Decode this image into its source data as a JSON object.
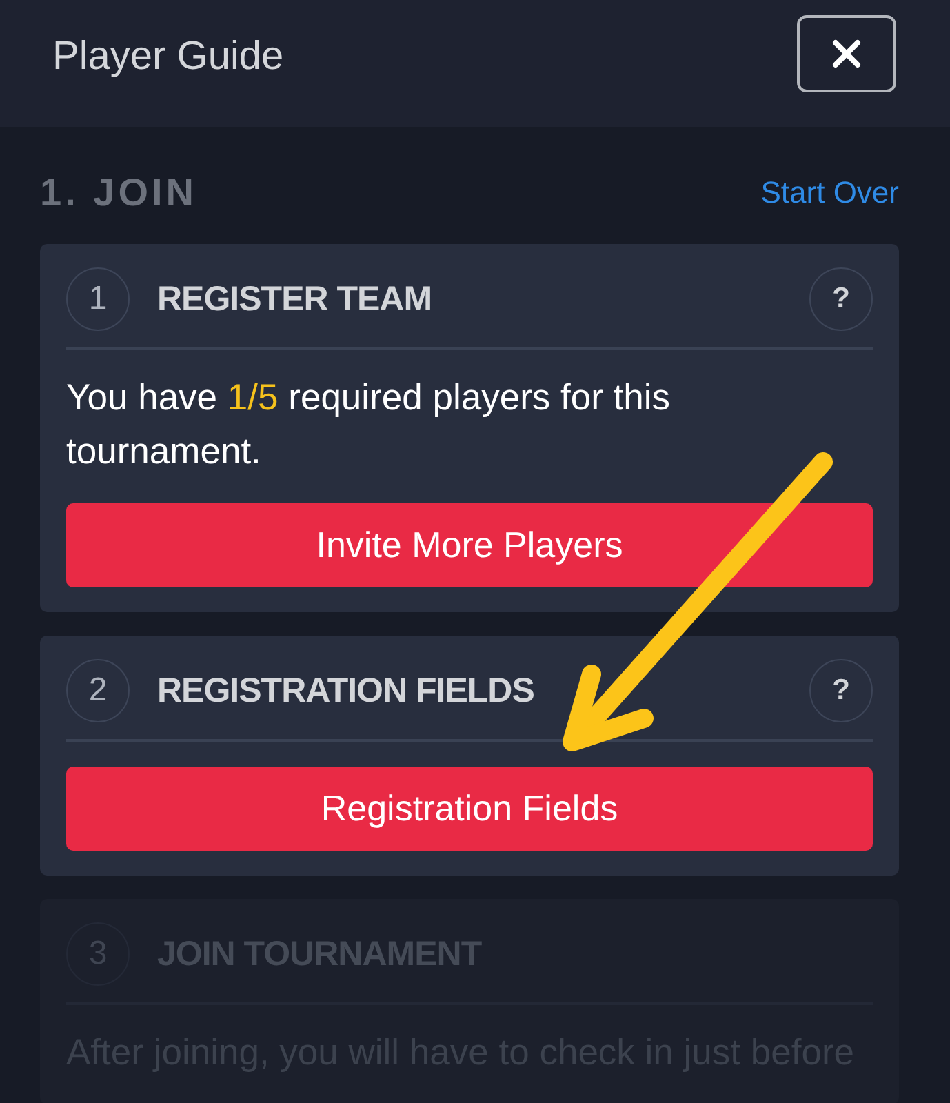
{
  "header": {
    "title": "Player Guide"
  },
  "section": {
    "title": "1. JOIN",
    "link": "Start Over"
  },
  "steps": [
    {
      "number": "1",
      "title": "REGISTER TEAM",
      "help_label": "?",
      "disabled": false,
      "message": [
        {
          "text": "You have ",
          "highlight": false
        },
        {
          "text": "1/5",
          "highlight": true
        },
        {
          "text": " required players for this tournament.",
          "highlight": false
        }
      ],
      "button": "Invite More Players"
    },
    {
      "number": "2",
      "title": "REGISTRATION FIELDS",
      "help_label": "?",
      "disabled": false,
      "button": "Registration Fields"
    },
    {
      "number": "3",
      "title": "JOIN TOURNAMENT",
      "disabled": true,
      "message": [
        {
          "text": "After joining, you will have to check in just before",
          "highlight": false
        }
      ]
    }
  ]
}
